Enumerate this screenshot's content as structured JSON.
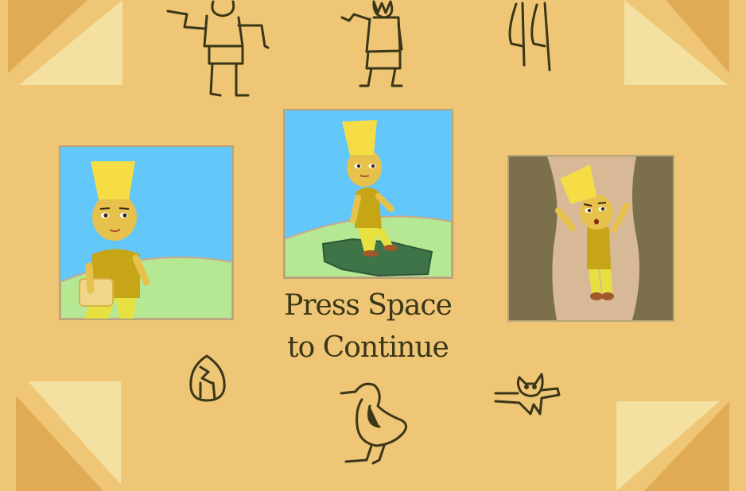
{
  "screen": {
    "prompt_line1": "Press Space",
    "prompt_line2": "to Continue"
  },
  "colors": {
    "background": "#eec675",
    "corner_light": "#f4e0a0",
    "corner_dark": "#e1ab56",
    "glyph_ink": "#3a3618",
    "sky": "#64c7f9",
    "grass": "#b6e793",
    "skin": "#e6c24c",
    "hat": "#f6dd46",
    "tunic": "#c6a617",
    "legs": "#e7e041",
    "rock": "#3e7448",
    "cave_wall": "#7b704b",
    "cave_floor": "#d7b997"
  },
  "icons": [
    "man-running-hieroglyph",
    "man-walking-hieroglyph",
    "reed-leaves-hieroglyph",
    "placenta-hieroglyph",
    "quail-chick-hieroglyph",
    "horned-viper-hieroglyph"
  ],
  "panels": [
    "story-panel-walking",
    "story-panel-on-rock",
    "story-panel-falling"
  ]
}
